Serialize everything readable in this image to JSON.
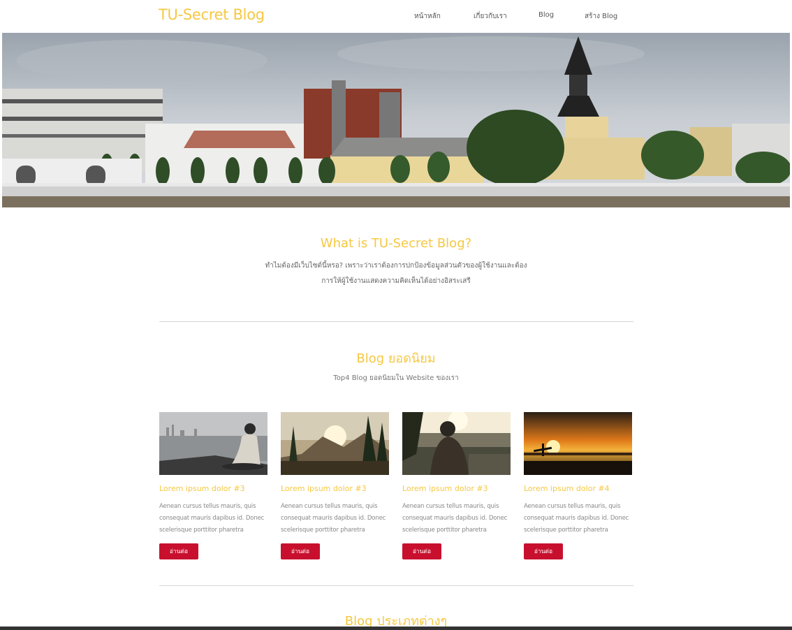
{
  "navbar": {
    "brand": "TU-Secret Blog",
    "items": [
      {
        "label": "หน้าหลัก"
      },
      {
        "label": "เกี่ยวกับเรา"
      },
      {
        "label": "Blog"
      },
      {
        "label": "สร้าง Blog"
      }
    ]
  },
  "about": {
    "title": "What is TU-Secret Blog?",
    "line1": "ทำไมต้องมีเว็บไซต์นี้หรอ? เพราะว่าเราต้องการปกป้องข้อมูลส่วนตัวของผู้ใช้งานและต้อง",
    "line2": "การให้ผู้ใช้งานแสดงความคิดเห็นได้อย่างอิสระเสรี"
  },
  "popular": {
    "title": "Blog ยอดนิยม",
    "subtitle": "Top4 Blog ยอดนิยมใน Website ของเรา",
    "cards": [
      {
        "title": "Lorem ipsum dolor #3",
        "desc": "Aenean cursus tellus mauris, quis consequat mauris dapibus id. Donec scelerisque porttitor pharetra",
        "button": "อ่านต่อ"
      },
      {
        "title": "Lorem ipsum dolor #3",
        "desc": "Aenean cursus tellus mauris, quis consequat mauris dapibus id. Donec scelerisque porttitor pharetra",
        "button": "อ่านต่อ"
      },
      {
        "title": "Lorem ipsum dolor #3",
        "desc": "Aenean cursus tellus mauris, quis consequat mauris dapibus id. Donec scelerisque porttitor pharetra",
        "button": "อ่านต่อ"
      },
      {
        "title": "Lorem ipsum dolor #4",
        "desc": "Aenean cursus tellus mauris, quis consequat mauris dapibus id. Donec scelerisque porttitor pharetra",
        "button": "อ่านต่อ"
      }
    ]
  },
  "categories": {
    "title": "Blog ประเภทต่างๆ"
  },
  "colors": {
    "accent": "#f5c842",
    "button": "#c8102e"
  }
}
